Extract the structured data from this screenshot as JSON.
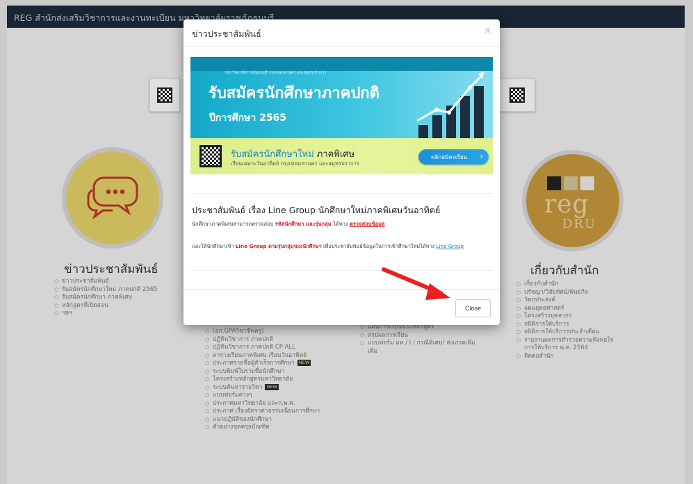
{
  "navbar": {
    "brand": "REG สำนักส่งเสริมวิชาการและงานทะเบียน มหาวิทยาลัยราชภัฏธนบุรี"
  },
  "icons": {
    "chat": "chat-bubble-icon",
    "qr": "qr-code-icon",
    "close": "close-icon",
    "arrow": "red-arrow-annotation"
  },
  "colors": {
    "accent": "#1d83c6",
    "highlight_red": "#d2232a",
    "news_circle": "#e8d36a",
    "reg_circle": "#c99a3d",
    "arrow": "#e82020"
  },
  "background": {
    "news": {
      "title": "ข่าวประชาสัมพันธ์",
      "items": [
        "ข่าวประชาสัมพันธ์",
        "รับสมัครนักศึกษาใหม่ ภาคปกติ 2565",
        "รับสมัครนักศึกษา ภาคพิเศษ",
        "หลักสูตรที่เปิดสอน",
        "ฯลฯ"
      ]
    },
    "reg_logo": {
      "line1": "reg",
      "line2": "DRU"
    },
    "about": {
      "title": "เกี่ยวกับสำนัก",
      "items": [
        "เกี่ยวกับสำนัก",
        "ปรัชญา/วิสัยทัศน์/พันธกิจ",
        "วัตถุประสงค์",
        "แผนยุทธศาสตร์",
        "โครงสร้างบุคลากร",
        "สถิติการให้บริการ",
        "สถิติการให้บริการประจำเดือน",
        "รายงานผลการสำรวจความพึงพอใจการให้บริการ พ.ศ. 2564",
        "ติดต่อสำนัก"
      ]
    },
    "middle": {
      "items": [
        "(อก.GPAวิชาชีพครู)",
        "ปฏิทินวิชาการ ภาคปกติ",
        "ปฏิทินวิชาการ ภาคปกติ CP ALL",
        "ตารางเรียนภาคพิเศษ เรียนวันอาทิตย์",
        "ประกาศรายชื่อผู้สำเร็จการศึกษา",
        "ระบบพิมพ์ใบรายชื่อนักศึกษา",
        "โครงสร้างหลักสูตรมหาวิทยาลัย",
        "ระบบค้นหารายวิชา",
        "แบบฟอร์มต่างๆ",
        "ประกาศมหาวิทยาลัย และก.พ.ศ.",
        "ประกาศ เรื่องอัตราค่าธรรมเนียมการศึกษา",
        "แนวปฏิบัติของนักศึกษา",
        "ตัวอย่างชุดครุยบัณฑิต"
      ],
      "new_badge": "NEW"
    },
    "forms": {
      "items": [
        "แผนการเรียนของหลักสูตร",
        "สรุปผลการเรียน",
        "แบบฟอร์ม มท / I / กรณีพิเศษ/ ส่งเกรดเพิ่มเติม"
      ]
    }
  },
  "modal": {
    "title": "ข่าวประชาสัมพันธ์",
    "close_symbol": "×",
    "banner1": {
      "small": "มหาวิทยาลัยราชภัฏธนบุรี กรุงเทพมหานคร และสมุทรปราการ",
      "headline": "รับสมัครนักศึกษาภาคปกติ",
      "year": "ปีการศึกษา 2565"
    },
    "banner2": {
      "title_blue": "รับสมัครนักศึกษาใหม่",
      "title_dark": "ภาคพิเศษ",
      "subtitle": "เรียนเฉพาะวันอาทิตย์ กรุงเทพมหานคร และสมุทรปราการ",
      "button": "คลิกสมัครเรียน",
      "button_chevron": "›"
    },
    "announcement": {
      "title": "ประชาสัมพันธ์ เรื่อง Line Group นักศึกษาใหม่ภาคพิเศษวันอาทิตย์",
      "line1_prefix": "นักศึกษาภาคพิเศษสามารถตรวจสอบ",
      "line1_red": "รหัสนักศึกษา และรุ่นกลุ่ม",
      "line1_mid": "ได้ทาง",
      "line1_link": "ตรวจสอบข้อมูล",
      "para_prefix": "และให้นักศึกษาเข้า",
      "para_red": "Line Group ตามรุ่นกลุ่มของนักศึกษา",
      "para_mid": "เพื่อประชาสัมพันธ์ข้อมูลในการเข้าศึกษาใหม่ได้ทาง",
      "para_link": "Line Group"
    },
    "footer": {
      "close_label": "Close"
    }
  }
}
